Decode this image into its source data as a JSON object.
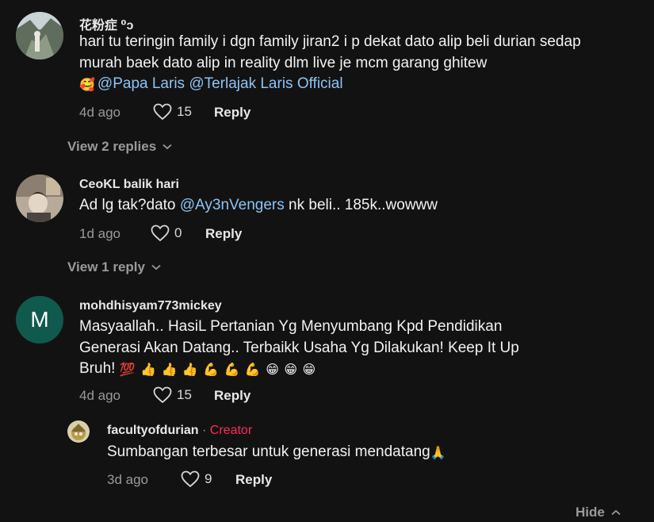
{
  "comments": [
    {
      "username": "花粉症 ⁰ɔ",
      "text_before": "hari tu teringin family i dgn family jiran2 i p dekat dato alip beli durian sedap murah baek dato alip in reality dlm live je mcm garang ghitew",
      "emoji_lead": "🥰",
      "mention1": "@Papa Laris",
      "mention2": "@Terlajak Laris Official",
      "time": "4d ago",
      "likes": "15",
      "reply_label": "Reply",
      "view_replies": "View 2 replies"
    },
    {
      "username": "CeoKL balik hari",
      "text_before": "Ad lg tak?dato",
      "mention": "@Ay3nVengers",
      "text_after": "nk beli.. 185k..wowww",
      "time": "1d ago",
      "likes": "0",
      "reply_label": "Reply",
      "view_replies": "View 1 reply"
    },
    {
      "avatar_letter": "M",
      "username": "mohdhisyam773mickey",
      "text": "Masyaallah.. HasiL Pertanian Yg Menyumbang Kpd Pendidikan Generasi Akan Datang.. Terbaikk Usaha Yg Dilakukan! Keep It Up Bruh!",
      "emojis": "💯 👍 👍 👍 💪 💪 💪 😁 😁 😁",
      "time": "4d ago",
      "likes": "15",
      "reply_label": "Reply"
    }
  ],
  "reply": {
    "username": "facultyofdurian",
    "separator": "·",
    "creator_badge": "Creator",
    "text": "Sumbangan terbesar untuk generasi mendatang",
    "emoji": "🙏",
    "time": "3d ago",
    "likes": "9",
    "reply_label": "Reply"
  },
  "hide_label": "Hide",
  "colors": {
    "background": "#121212",
    "mention": "#8cc4f5",
    "creator": "#fe2c55",
    "avatar_m": "#0f5a4c"
  }
}
